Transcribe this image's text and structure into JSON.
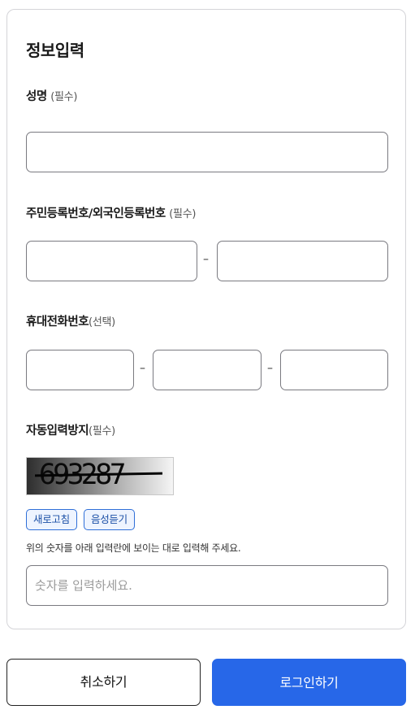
{
  "form": {
    "title": "정보입력",
    "name_field": {
      "label": "성명",
      "hint": "(필수)"
    },
    "resident_field": {
      "label": "주민등록번호/외국인등록번호",
      "hint": "(필수)",
      "separator": "–"
    },
    "phone_field": {
      "label": "휴대전화번호",
      "hint": "(선택)",
      "separator": "–"
    },
    "captcha": {
      "label": "자동입력방지",
      "hint": "(필수)",
      "code": "693287",
      "refresh_label": "새로고침",
      "audio_label": "음성듣기",
      "instruction": "위의 숫자를 아래 입력란에 보이는 대로 입력해 주세요.",
      "placeholder": "숫자를 입력하세요."
    }
  },
  "actions": {
    "cancel_label": "취소하기",
    "login_label": "로그인하기"
  },
  "colors": {
    "accent": "#2767e8",
    "chip_border": "#2f6fd8",
    "border": "#7a7a80"
  }
}
